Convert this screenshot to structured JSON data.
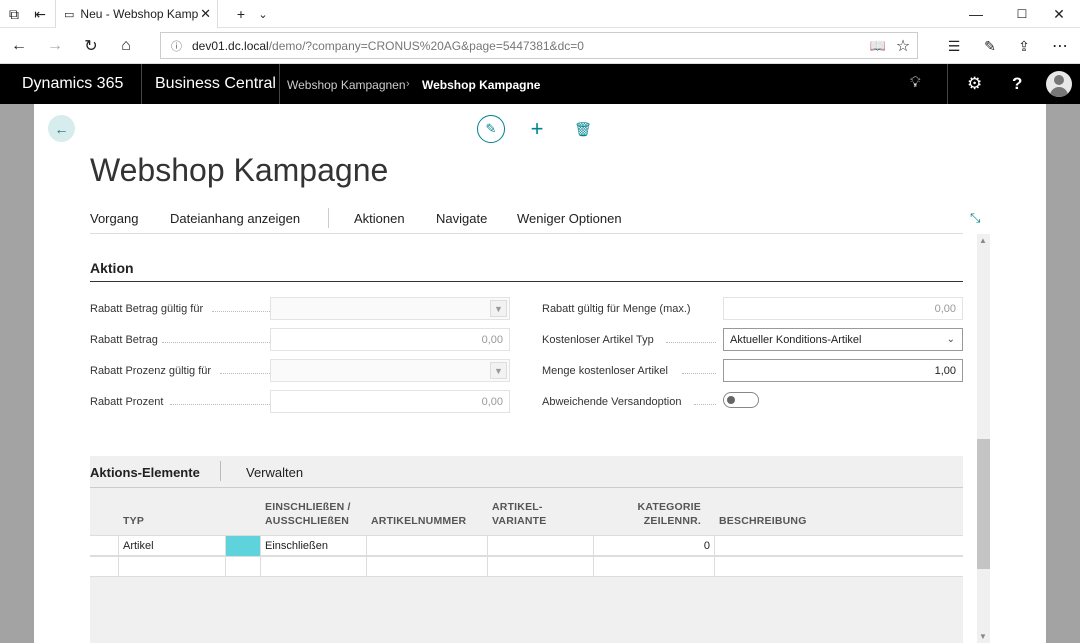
{
  "browser": {
    "tab_title": "Neu - Webshop Kampagne",
    "url_host": "dev01.dc.local",
    "url_path": "/demo/?company=CRONUS%20AG&page=5447381&dc=0"
  },
  "nav": {
    "product": "Dynamics 365",
    "app": "Business Central",
    "breadcrumb_parent": "Webshop Kampagnen",
    "breadcrumb_current": "Webshop Kampagne"
  },
  "page": {
    "title": "Webshop Kampagne"
  },
  "menu": {
    "items": [
      "Vorgang",
      "Dateianhang anzeigen",
      "Aktionen",
      "Navigate",
      "Weniger Optionen"
    ]
  },
  "section": {
    "title": "Aktion",
    "left_fields": [
      {
        "label": "Rabatt Betrag gültig für",
        "value": ""
      },
      {
        "label": "Rabatt Betrag",
        "value": "0,00"
      },
      {
        "label": "Rabatt Prozenz gültig für",
        "value": ""
      },
      {
        "label": "Rabatt Prozent",
        "value": "0,00"
      }
    ],
    "right_fields": [
      {
        "label": "Rabatt gültig für Menge (max.)",
        "value": "0,00"
      },
      {
        "label": "Kostenloser Artikel Typ",
        "value": "Aktueller Konditions-Artikel"
      },
      {
        "label": "Menge kostenloser Artikel",
        "value": "1,00"
      },
      {
        "label": "Abweichende Versandoption",
        "value": ""
      }
    ]
  },
  "subpage": {
    "title": "Aktions-Elemente",
    "manage": "Verwalten",
    "headers": {
      "typ": "TYP",
      "einschl_1": "EINSCHLIEßEN /",
      "einschl_2": "AUSSCHLIEßEN",
      "artikelnr": "ARTIKELNUMMER",
      "variante_1": "ARTIKEL-",
      "variante_2": "VARIANTE",
      "kategorie_1": "KATEGORIE",
      "kategorie_2": "ZEILENNR.",
      "beschreibung": "BESCHREIBUNG"
    },
    "rows": [
      {
        "typ": "Artikel",
        "einschl": "Einschließen",
        "artikelnr": "",
        "variante": "",
        "zeilennr": "0",
        "beschreibung": ""
      }
    ]
  },
  "colors": {
    "accent": "#00838f",
    "selected_cell": "#5fd3dc"
  }
}
